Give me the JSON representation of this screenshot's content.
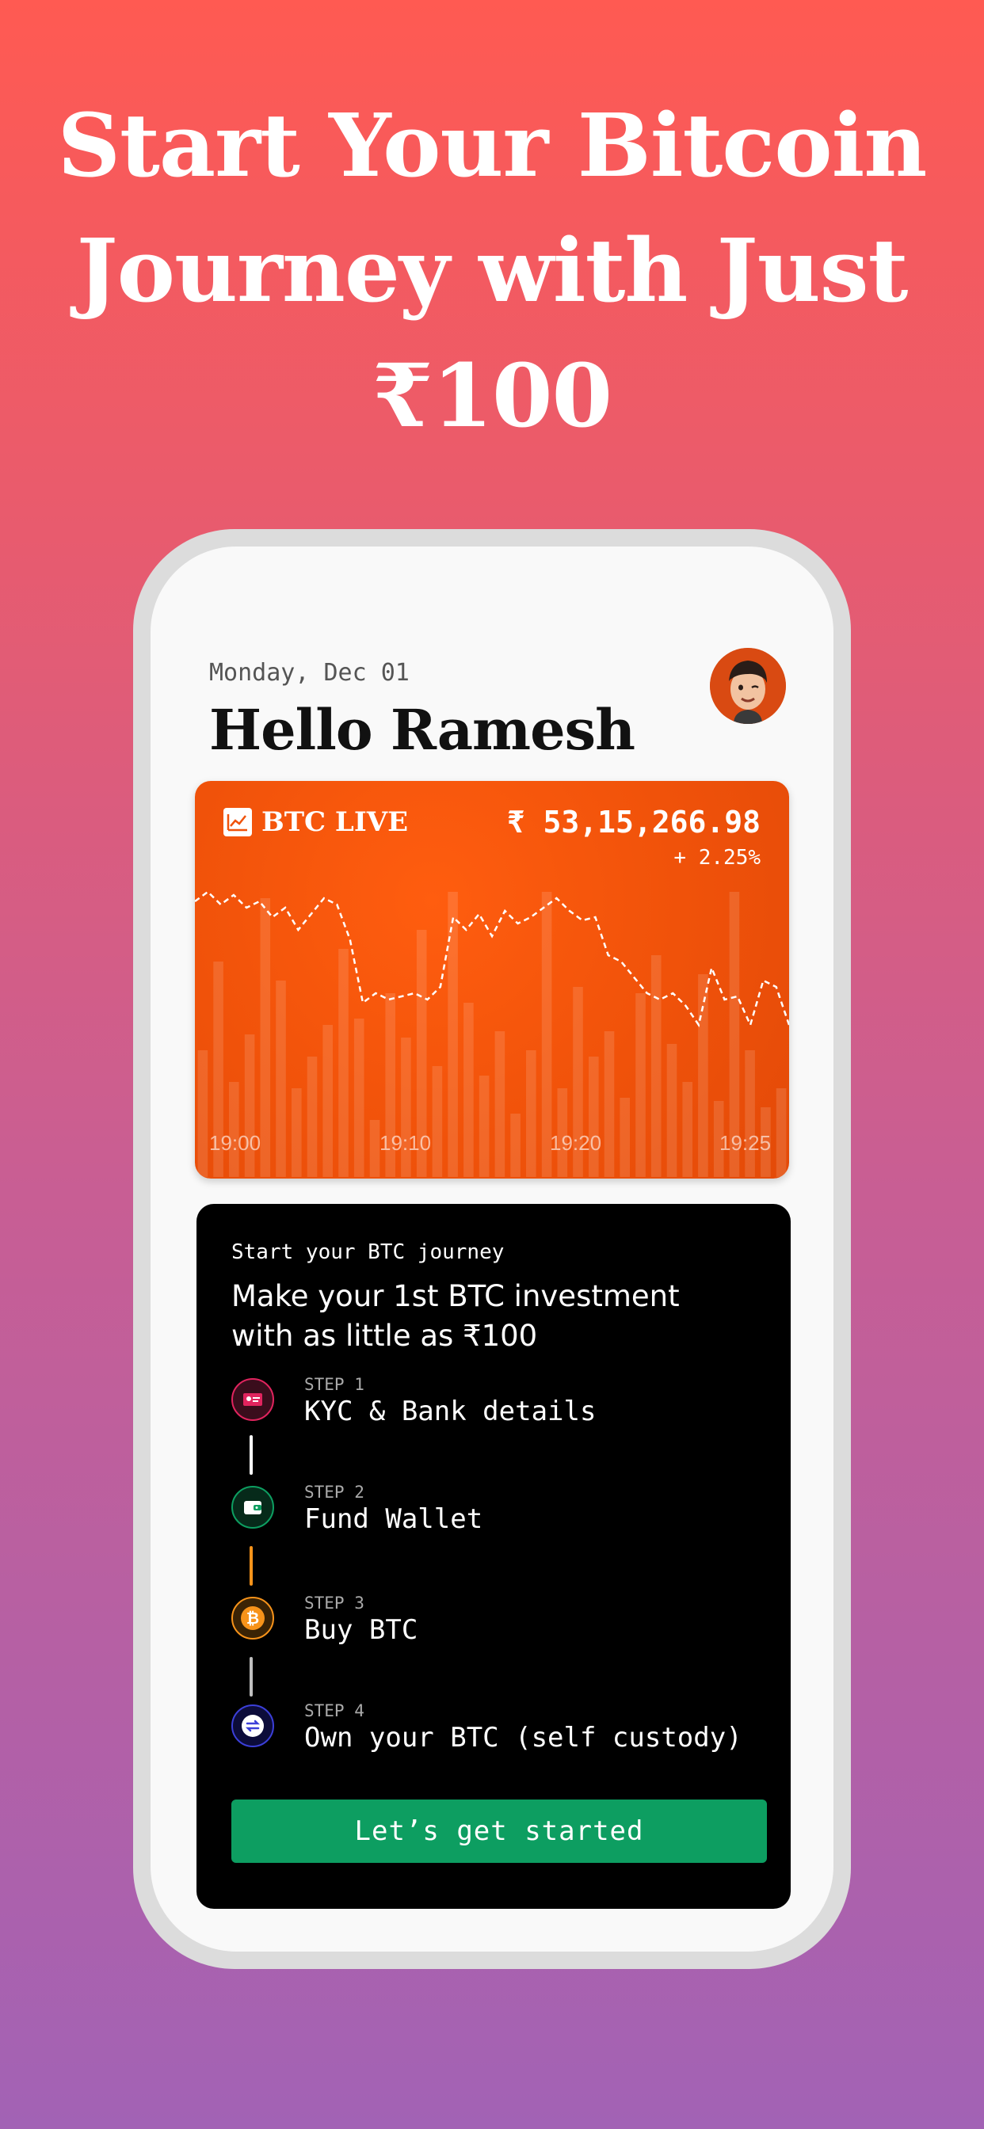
{
  "headline": {
    "line1": "Start Your Bitcoin",
    "line2": "Journey with Just",
    "line3": "₹100"
  },
  "header": {
    "date": "Monday, Dec 01",
    "greeting": "Hello Ramesh"
  },
  "btc_card": {
    "label": "BTC LIVE",
    "price": "₹ 53,15,266.98",
    "change": "+ 2.25%",
    "time_ticks": [
      "19:00",
      "19:10",
      "19:20",
      "19:25"
    ]
  },
  "journey": {
    "kicker": "Start your BTC journey",
    "title": "Make your 1st BTC investment with as little as ₹100",
    "steps": [
      {
        "label": "STEP 1",
        "text": "KYC & Bank details",
        "icon": "kyc-card-icon",
        "color": "#e0245e"
      },
      {
        "label": "STEP 2",
        "text": "Fund Wallet",
        "icon": "wallet-icon",
        "color": "#0d9e61"
      },
      {
        "label": "STEP 3",
        "text": "Buy BTC",
        "icon": "bitcoin-icon",
        "color": "#f7931a"
      },
      {
        "label": "STEP 4",
        "text": "Own your BTC (self custody)",
        "icon": "exchange-icon",
        "color": "#3b3fd8"
      }
    ],
    "cta": "Let’s get started"
  },
  "chart_data": {
    "type": "line",
    "line_values": [
      0.87,
      0.9,
      0.86,
      0.89,
      0.85,
      0.87,
      0.82,
      0.85,
      0.78,
      0.83,
      0.88,
      0.86,
      0.75,
      0.55,
      0.58,
      0.56,
      0.57,
      0.58,
      0.56,
      0.6,
      0.82,
      0.78,
      0.83,
      0.76,
      0.84,
      0.8,
      0.82,
      0.85,
      0.88,
      0.84,
      0.81,
      0.82,
      0.7,
      0.68,
      0.63,
      0.58,
      0.56,
      0.58,
      0.54,
      0.48,
      0.66,
      0.56,
      0.57,
      0.48,
      0.62,
      0.6,
      0.48
    ],
    "bar_values": [
      0.4,
      0.68,
      0.3,
      0.45,
      0.88,
      0.62,
      0.28,
      0.38,
      0.48,
      0.72,
      0.5,
      0.18,
      0.58,
      0.44,
      0.78,
      0.35,
      0.9,
      0.55,
      0.32,
      0.46,
      0.2,
      0.4,
      0.9,
      0.28,
      0.6,
      0.38,
      0.46,
      0.25,
      0.58,
      0.7,
      0.42,
      0.3,
      0.64,
      0.24,
      0.9,
      0.4,
      0.22,
      0.28
    ]
  }
}
